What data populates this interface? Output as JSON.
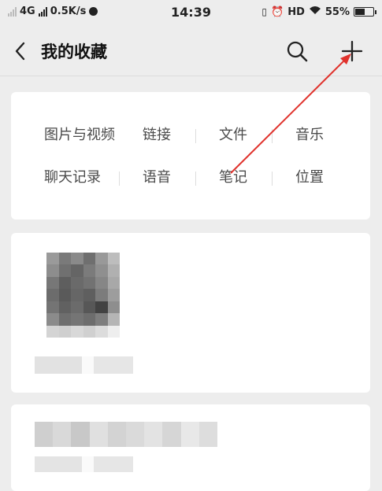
{
  "status_bar": {
    "network": "4G",
    "speed": "0.5K/s",
    "time": "14:39",
    "hd": "HD",
    "battery": "55%",
    "battery_level": 0.55
  },
  "header": {
    "title": "我的收藏",
    "icons": [
      "back-icon",
      "search-icon",
      "plus-icon"
    ]
  },
  "categories": {
    "row1": [
      "图片与视频",
      "链接",
      "文件",
      "音乐"
    ],
    "row2": [
      "聊天记录",
      "语音",
      "笔记",
      "位置"
    ]
  },
  "colors": {
    "background": "#ededed",
    "card": "#ffffff",
    "text": "#4a4a4a",
    "title": "#111111",
    "annotation_arrow": "#e0322c"
  }
}
